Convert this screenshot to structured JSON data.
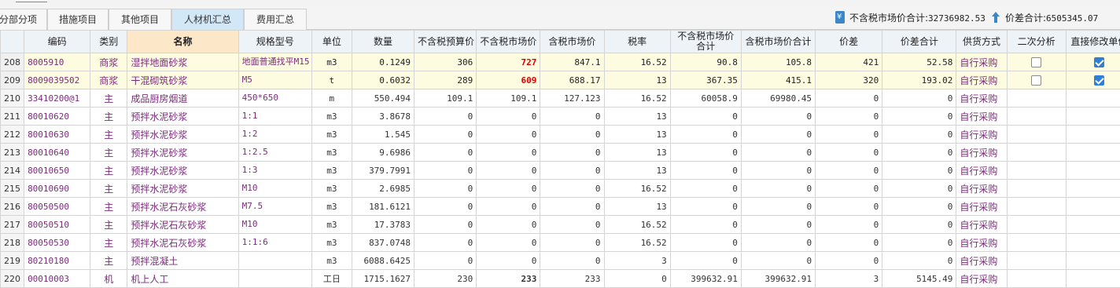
{
  "tabs": [
    {
      "label": "分部分项",
      "active": false
    },
    {
      "label": "措施项目",
      "active": false
    },
    {
      "label": "其他项目",
      "active": false
    },
    {
      "label": "人材机汇总",
      "active": true
    },
    {
      "label": "费用汇总",
      "active": false
    }
  ],
  "summary": {
    "pretax_label": "不含税市场价合计:",
    "pretax_value": "32736982.53",
    "diff_label": "价差合计:",
    "diff_value": "6505345.07"
  },
  "columns": [
    "",
    "编码",
    "类别",
    "名称",
    "规格型号",
    "单位",
    "数量",
    "不含税预算价",
    "不含税市场价",
    "含税市场价",
    "税率",
    "不含税市场价合计",
    "含税市场价合计",
    "价差",
    "价差合计",
    "供货方式",
    "二次分析",
    "直接修改单价"
  ],
  "rows": [
    {
      "no": "208",
      "code": "8005910",
      "cat": "商浆",
      "name": "湿拌地面砂浆",
      "spec": "地面普通找平M15",
      "unit": "m3",
      "qty": "0.1249",
      "budget": "306",
      "market": "727",
      "market_red": true,
      "tax_market": "847.1",
      "rate": "16.52",
      "pretax_total": "90.8",
      "tax_total": "105.8",
      "diff": "421",
      "diff_total": "52.58",
      "supply": "自行采购",
      "cb1": false,
      "cb2": true,
      "hl": true
    },
    {
      "no": "209",
      "code": "8009039502",
      "cat": "商浆",
      "name": "干混砌筑砂浆",
      "spec": "M5",
      "unit": "t",
      "qty": "0.6032",
      "budget": "289",
      "market": "609",
      "market_red": true,
      "tax_market": "688.17",
      "rate": "13",
      "pretax_total": "367.35",
      "tax_total": "415.1",
      "diff": "320",
      "diff_total": "193.02",
      "supply": "自行采购",
      "cb1": false,
      "cb2": true,
      "hl": true
    },
    {
      "no": "210",
      "code": "33410200@1",
      "cat": "主",
      "name": "成品厨房烟道",
      "spec": "450*650",
      "unit": "m",
      "qty": "550.494",
      "budget": "109.1",
      "market": "109.1",
      "market_red": false,
      "tax_market": "127.123",
      "rate": "16.52",
      "pretax_total": "60058.9",
      "tax_total": "69980.45",
      "diff": "0",
      "diff_total": "0",
      "supply": "自行采购",
      "cb1": null,
      "cb2": null,
      "hl": false
    },
    {
      "no": "211",
      "code": "80010620",
      "cat": "主",
      "name": "预拌水泥砂浆",
      "spec": "1:1",
      "unit": "m3",
      "qty": "3.8678",
      "budget": "0",
      "market": "0",
      "market_red": false,
      "tax_market": "0",
      "rate": "13",
      "pretax_total": "0",
      "tax_total": "0",
      "diff": "0",
      "diff_total": "0",
      "supply": "自行采购",
      "cb1": null,
      "cb2": null,
      "hl": false
    },
    {
      "no": "212",
      "code": "80010630",
      "cat": "主",
      "name": "预拌水泥砂浆",
      "spec": "1:2",
      "unit": "m3",
      "qty": "1.545",
      "budget": "0",
      "market": "0",
      "market_red": false,
      "tax_market": "0",
      "rate": "13",
      "pretax_total": "0",
      "tax_total": "0",
      "diff": "0",
      "diff_total": "0",
      "supply": "自行采购",
      "cb1": null,
      "cb2": null,
      "hl": false
    },
    {
      "no": "213",
      "code": "80010640",
      "cat": "主",
      "name": "预拌水泥砂浆",
      "spec": "1:2.5",
      "unit": "m3",
      "qty": "9.6986",
      "budget": "0",
      "market": "0",
      "market_red": false,
      "tax_market": "0",
      "rate": "13",
      "pretax_total": "0",
      "tax_total": "0",
      "diff": "0",
      "diff_total": "0",
      "supply": "自行采购",
      "cb1": null,
      "cb2": null,
      "hl": false
    },
    {
      "no": "214",
      "code": "80010650",
      "cat": "主",
      "name": "预拌水泥砂浆",
      "spec": "1:3",
      "unit": "m3",
      "qty": "379.7991",
      "budget": "0",
      "market": "0",
      "market_red": false,
      "tax_market": "0",
      "rate": "13",
      "pretax_total": "0",
      "tax_total": "0",
      "diff": "0",
      "diff_total": "0",
      "supply": "自行采购",
      "cb1": null,
      "cb2": null,
      "hl": false
    },
    {
      "no": "215",
      "code": "80010690",
      "cat": "主",
      "name": "预拌水泥砂浆",
      "spec": "M10",
      "unit": "m3",
      "qty": "2.6985",
      "budget": "0",
      "market": "0",
      "market_red": false,
      "tax_market": "0",
      "rate": "16.52",
      "pretax_total": "0",
      "tax_total": "0",
      "diff": "0",
      "diff_total": "0",
      "supply": "自行采购",
      "cb1": null,
      "cb2": null,
      "hl": false
    },
    {
      "no": "216",
      "code": "80050500",
      "cat": "主",
      "name": "预拌水泥石灰砂浆",
      "spec": "M7.5",
      "unit": "m3",
      "qty": "181.6121",
      "budget": "0",
      "market": "0",
      "market_red": false,
      "tax_market": "0",
      "rate": "13",
      "pretax_total": "0",
      "tax_total": "0",
      "diff": "0",
      "diff_total": "0",
      "supply": "自行采购",
      "cb1": null,
      "cb2": null,
      "hl": false
    },
    {
      "no": "217",
      "code": "80050510",
      "cat": "主",
      "name": "预拌水泥石灰砂浆",
      "spec": "M10",
      "unit": "m3",
      "qty": "17.3783",
      "budget": "0",
      "market": "0",
      "market_red": false,
      "tax_market": "0",
      "rate": "16.52",
      "pretax_total": "0",
      "tax_total": "0",
      "diff": "0",
      "diff_total": "0",
      "supply": "自行采购",
      "cb1": null,
      "cb2": null,
      "hl": false
    },
    {
      "no": "218",
      "code": "80050530",
      "cat": "主",
      "name": "预拌水泥石灰砂浆",
      "spec": "1:1:6",
      "unit": "m3",
      "qty": "837.0748",
      "budget": "0",
      "market": "0",
      "market_red": false,
      "tax_market": "0",
      "rate": "16.52",
      "pretax_total": "0",
      "tax_total": "0",
      "diff": "0",
      "diff_total": "0",
      "supply": "自行采购",
      "cb1": null,
      "cb2": null,
      "hl": false
    },
    {
      "no": "219",
      "code": "80210180",
      "cat": "主",
      "name": "预拌混凝土",
      "spec": "",
      "unit": "m3",
      "qty": "6088.6425",
      "budget": "0",
      "market": "0",
      "market_red": false,
      "tax_market": "0",
      "rate": "3",
      "pretax_total": "0",
      "tax_total": "0",
      "diff": "0",
      "diff_total": "0",
      "supply": "自行采购",
      "cb1": null,
      "cb2": null,
      "hl": false
    },
    {
      "no": "220",
      "code": "00010003",
      "cat": "机",
      "name": "机上人工",
      "spec": "",
      "unit": "工日",
      "qty": "1715.1627",
      "budget": "230",
      "market": "233",
      "market_red": true,
      "tax_market": "233",
      "rate": "0",
      "pretax_total": "399632.91",
      "tax_total": "399632.91",
      "diff": "3",
      "diff_total": "5145.49",
      "supply": "自行采购",
      "cb1": null,
      "cb2": null,
      "hl": false
    }
  ]
}
